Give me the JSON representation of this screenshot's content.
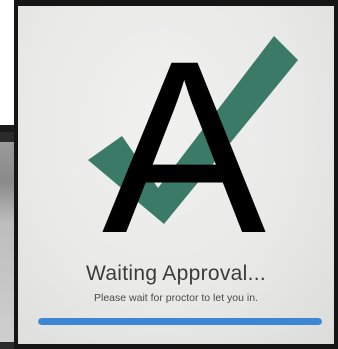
{
  "status": {
    "title": "Waiting Approval...",
    "subtitle": "Please wait for proctor to let you in."
  },
  "progress": {
    "fraction": 1.0
  },
  "logo": {
    "letter": "A",
    "icon": "checkmark-icon",
    "check_color": "#3b7a67",
    "letter_color": "#000000"
  },
  "colors": {
    "progress_bar": "#3d86d6",
    "screen_background": "#ececeb"
  }
}
